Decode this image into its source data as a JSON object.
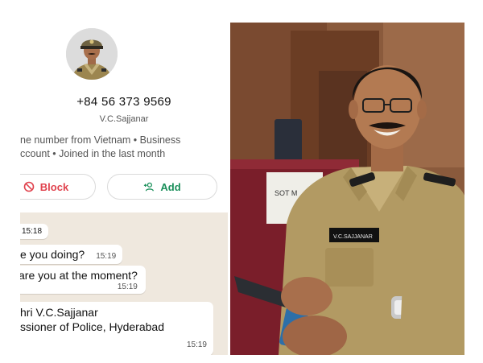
{
  "contact": {
    "phone": "+84 56 373 9569",
    "display_name": "V.C.Sajjanar",
    "info_line_1": "ne number from Vietnam • Business",
    "info_line_2": "ccount • Joined in the last month"
  },
  "actions": {
    "block_label": "Block",
    "add_label": "Add"
  },
  "messages": {
    "first_time": "15:18",
    "msg1_text": "e you doing?",
    "msg1_time": "15:19",
    "msg2_text": "are you at the moment?",
    "msg2_time": "15:19",
    "msg3_line1": "hri V.C.Sajjanar",
    "msg3_line2": "ssioner of Police, Hyderabad",
    "msg3_time": "15:19"
  },
  "photo": {
    "placard": "SOT M",
    "name_tag": "V.C.SAJJANAR"
  },
  "colors": {
    "block_red": "#e0424d",
    "add_green": "#1a8f5a",
    "chat_bg": "#efe8de",
    "uniform_khaki": "#b29a63"
  }
}
